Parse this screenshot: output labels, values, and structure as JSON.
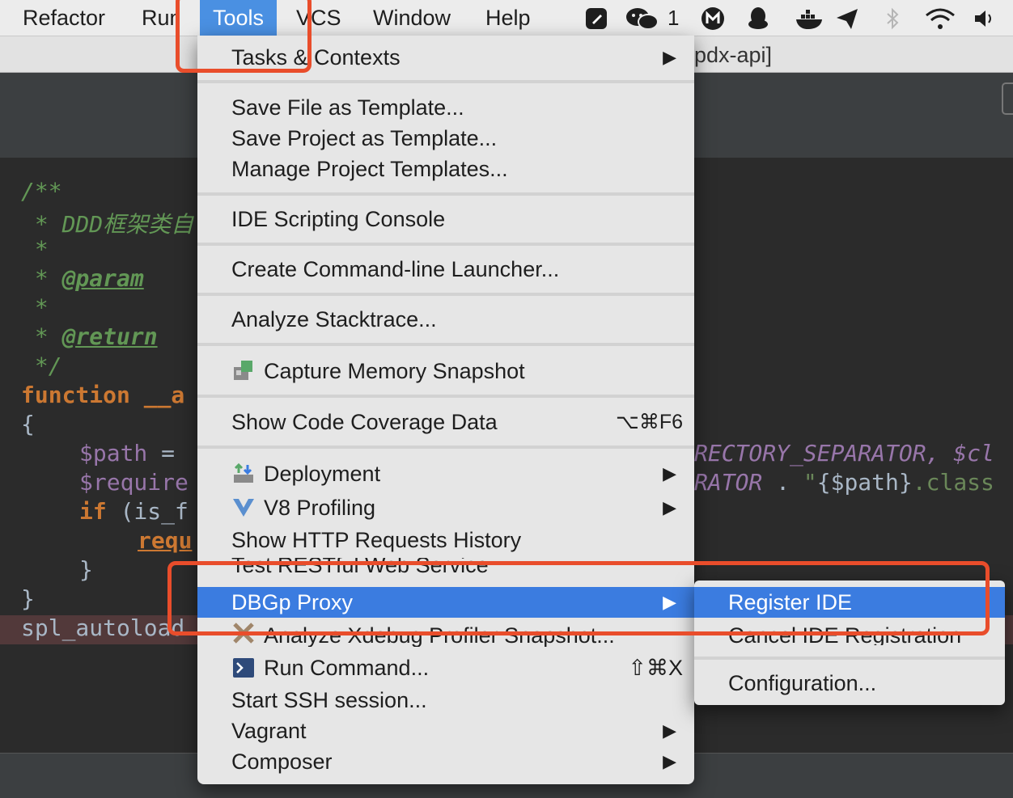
{
  "menubar": {
    "items": [
      "Refactor",
      "Run",
      "Tools",
      "VCS",
      "Window",
      "Help"
    ],
    "badge_count": "1"
  },
  "window": {
    "title": "pdx-api]"
  },
  "code": {
    "line1": "/**",
    "line2_prefix": " * ",
    "line2_text": "DDD框架类自",
    "line3": " *",
    "line4_prefix": " * ",
    "line4_tag": "@param",
    "line5": " *",
    "line6_prefix": " * ",
    "line6_tag": "@return",
    "line7": " */",
    "line8_kw": "function",
    "line8_rest": " __a",
    "line9": "{",
    "line10_var": "$path",
    "line10_rest": " = ",
    "line10_right": "RECTORY_SEPARATOR, $cl",
    "line11_var": "$require",
    "line11_right_const": "RATOR",
    "line11_right_op": " . ",
    "line11_right_str1": "\"",
    "line11_right_var": "{$path}",
    "line11_right_str2": ".class",
    "line12_kw": "if",
    "line12_rest": " (is_f",
    "line13_kw": "requ",
    "line14": "}",
    "line15": "}",
    "line16": "spl_autoload"
  },
  "tools_menu": {
    "tasks": "Tasks & Contexts",
    "save_file_template": "Save File as Template...",
    "save_project_template": "Save Project as Template...",
    "manage_templates": "Manage Project Templates...",
    "scripting_console": "IDE Scripting Console",
    "cmdline_launcher": "Create Command-line Launcher...",
    "analyze_stacktrace": "Analyze Stacktrace...",
    "capture_memory": "Capture Memory Snapshot",
    "code_coverage": "Show Code Coverage Data",
    "code_coverage_shortcut": "⌥⌘F6",
    "deployment": "Deployment",
    "v8_profiling": "V8 Profiling",
    "http_history": "Show HTTP Requests History",
    "restful": "Test RESTful Web Service",
    "dbgp_proxy": "DBGp Proxy",
    "xdebug_profiler": "Analyze Xdebug Profiler Snapshot...",
    "run_command": "Run Command...",
    "run_command_shortcut": "⇧⌘X",
    "ssh_session": "Start SSH session...",
    "vagrant": "Vagrant",
    "composer": "Composer"
  },
  "dbgp_submenu": {
    "register": "Register IDE",
    "cancel": "Cancel IDE Registration",
    "configuration": "Configuration..."
  },
  "colors": {
    "highlight": "#3b7ce0",
    "annotation": "#e94d2b",
    "menubar_active": "#4a90e2"
  }
}
